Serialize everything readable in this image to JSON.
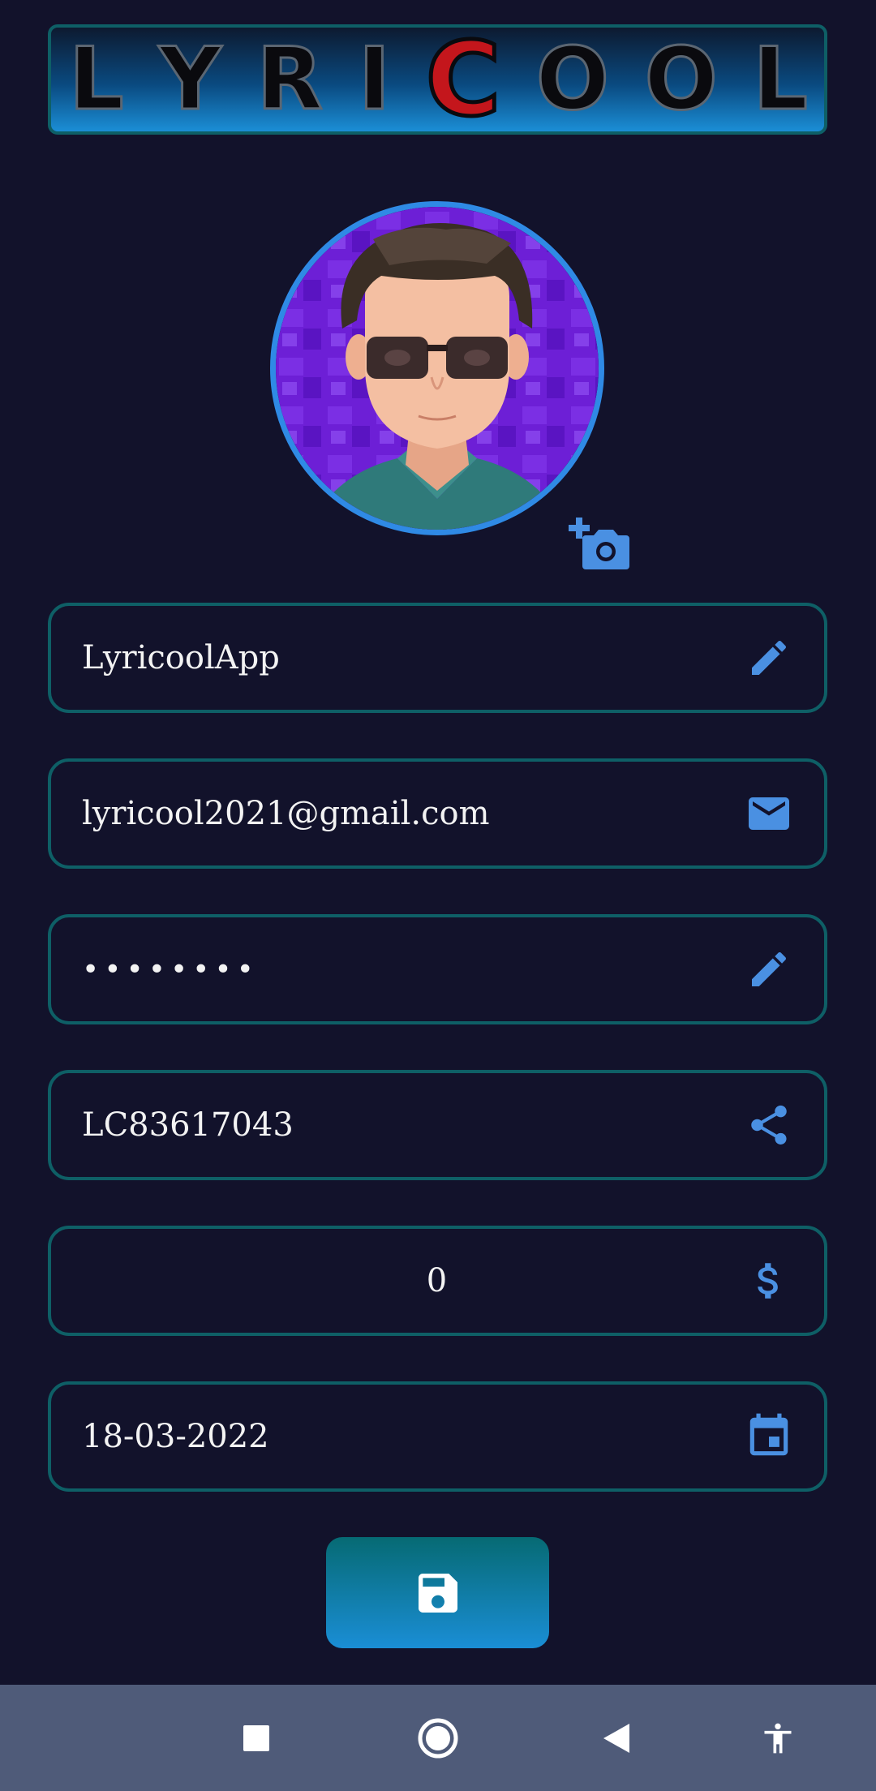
{
  "app": {
    "logo_letters": [
      "L",
      "Y",
      "R",
      "I",
      "C",
      "O",
      "O",
      "L"
    ],
    "logo_accent_index": 4
  },
  "profile": {
    "avatar_icon": "avatar-cartoon",
    "camera_icon": "add-a-photo-icon",
    "fields": {
      "username": {
        "value": "LyricoolApp",
        "icon": "edit-icon"
      },
      "email": {
        "value": "lyricool2021@gmail.com",
        "icon": "mail-icon"
      },
      "password": {
        "value": "••••••••",
        "icon": "edit-icon"
      },
      "referral_code": {
        "value": "LC83617043",
        "icon": "share-icon"
      },
      "balance": {
        "value": "0",
        "icon": "dollar-icon"
      },
      "date": {
        "value": "18-03-2022",
        "icon": "calendar-icon"
      }
    },
    "save_icon": "save-icon"
  },
  "colors": {
    "background": "#12122b",
    "border": "#0e5f66",
    "icon": "#4a90e2",
    "accent_red": "#c4161c",
    "nav_bar": "#4f5b79"
  },
  "system_nav": {
    "recents_icon": "square-icon",
    "home_icon": "circle-icon",
    "back_icon": "triangle-back-icon",
    "accessibility_icon": "accessibility-icon"
  }
}
